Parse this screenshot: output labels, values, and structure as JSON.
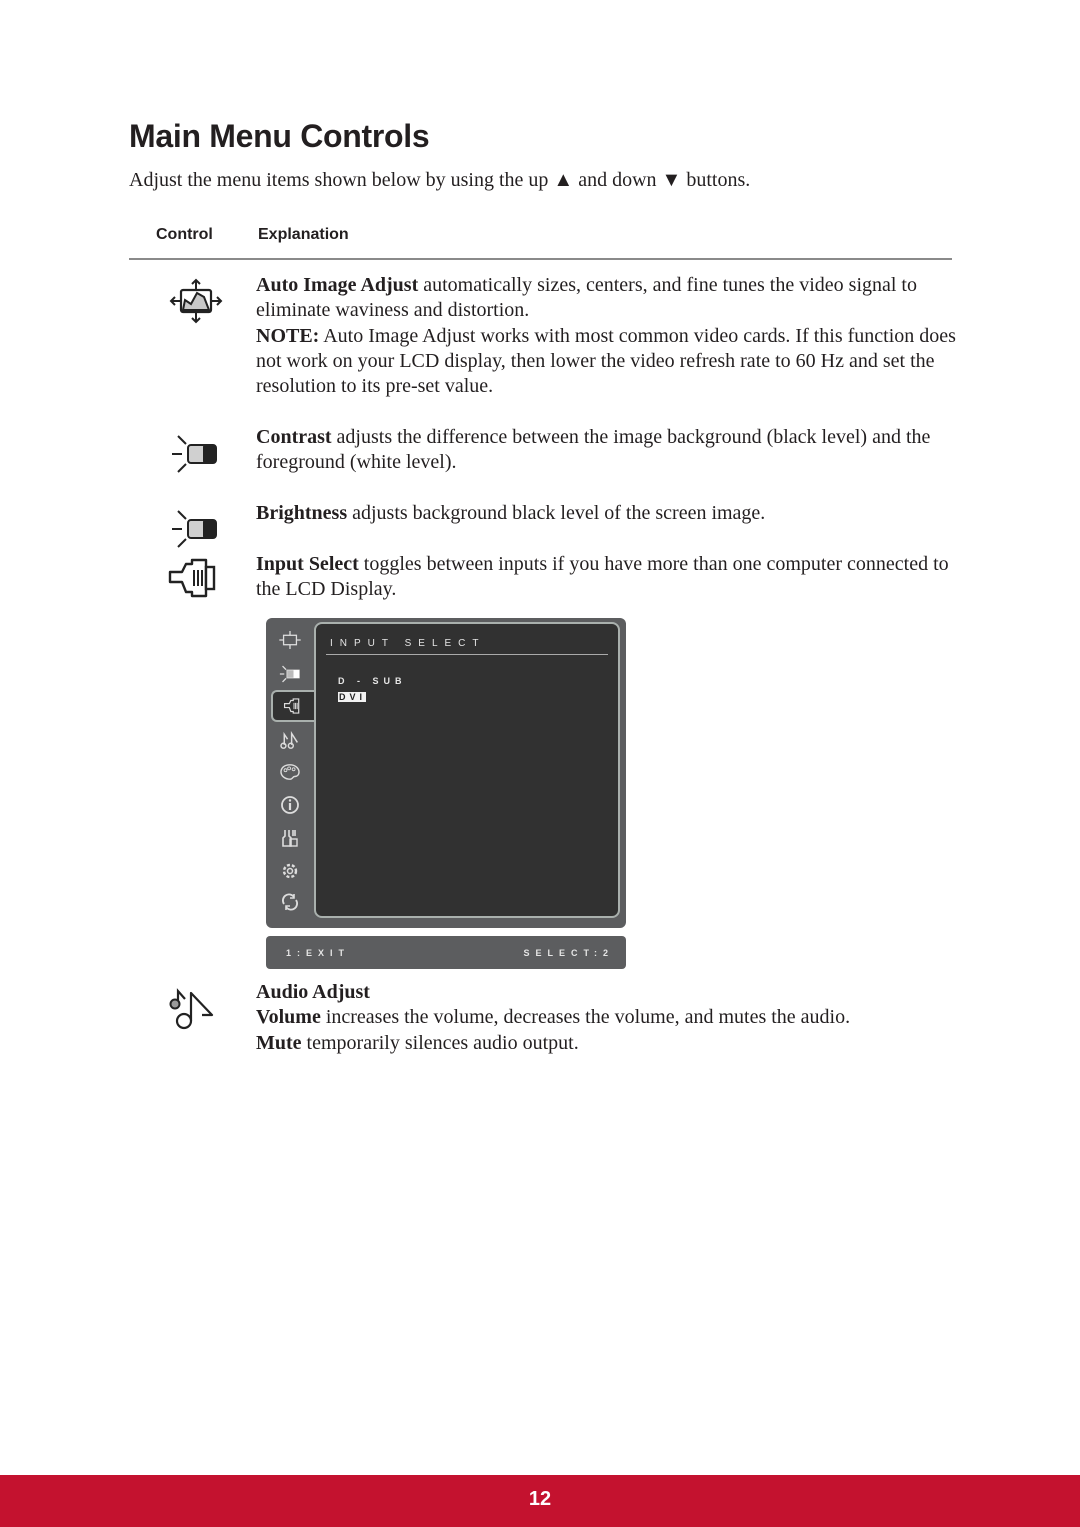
{
  "page": {
    "title": "Main Menu Controls",
    "intro": "Adjust the menu items shown below by using the up ▲ and down ▼ buttons.",
    "table_headers": {
      "control": "Control",
      "explanation": "Explanation"
    },
    "page_number": "12",
    "accent_color": "#c4122f"
  },
  "controls": [
    {
      "icon": "auto-image-adjust-icon",
      "term": "Auto Image Adjust",
      "text": " automatically sizes, centers, and fine tunes the video signal to eliminate waviness and distortion.",
      "note_label": "NOTE:",
      "note_text": " Auto Image Adjust works with most common video cards. If this function does not work on your LCD display, then lower the video refresh rate to 60 Hz and set the resolution to its pre-set value."
    },
    {
      "icon": "contrast-icon",
      "term": "Contrast",
      "text": " adjusts the difference between the image background (black level) and the foreground (white level)."
    },
    {
      "icon": "brightness-icon",
      "term": "Brightness",
      "text": " adjusts background black level of the screen image."
    },
    {
      "icon": "input-select-icon",
      "term": "Input Select",
      "text": " toggles between inputs if you have more than one computer connected to the LCD Display."
    },
    {
      "icon": "audio-adjust-icon",
      "heading": "Audio Adjust",
      "lines": [
        {
          "term": "Volume",
          "text": " increases the volume, decreases the volume, and mutes the audio."
        },
        {
          "term": "Mute",
          "text": " temporarily silences audio output."
        }
      ]
    }
  ],
  "osd": {
    "title": "INPUT SELECT",
    "options": [
      {
        "label": "D-SUB",
        "selected": false
      },
      {
        "label": "DVI",
        "selected": true
      }
    ],
    "sidebar_icons": [
      "auto-image-adjust-icon",
      "contrast-brightness-icon",
      "input-select-icon",
      "audio-icon",
      "color-palette-icon",
      "information-icon",
      "manual-adjust-icon",
      "setup-gear-icon",
      "memory-recall-icon"
    ],
    "active_index": 2,
    "exit_label": "1:EXIT",
    "select_label": "SELECT:2"
  }
}
